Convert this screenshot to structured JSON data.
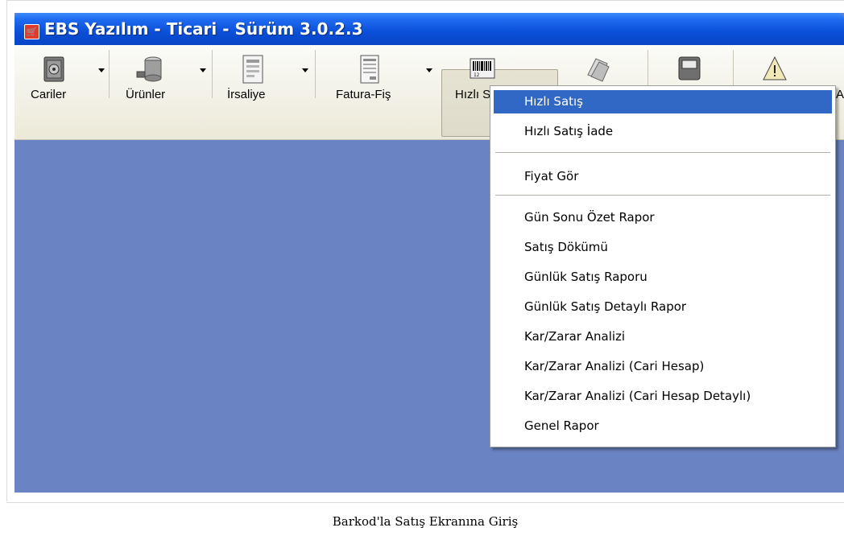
{
  "window": {
    "title": "EBS Yazılım - Ticari - Sürüm 3.0.2.3",
    "app_icon": "cart-icon",
    "app_icon_glyph": "⌘"
  },
  "toolbar": {
    "items": [
      {
        "label": "Cariler",
        "icon": "safe-icon",
        "has_dropdown": true
      },
      {
        "label": "Ürünler",
        "icon": "database-icon",
        "has_dropdown": true
      },
      {
        "label": "İrsaliye",
        "icon": "document-icon",
        "has_dropdown": true
      },
      {
        "label": "Fatura-Fiş",
        "icon": "invoice-icon",
        "has_dropdown": true
      },
      {
        "label": "Hızlı S",
        "icon": "barcode-icon",
        "has_dropdown": true,
        "pressed": true
      },
      {
        "label": "",
        "icon": "cash-icon",
        "has_dropdown": false
      },
      {
        "label": "",
        "icon": "pos-icon",
        "has_dropdown": false
      },
      {
        "label": "",
        "icon": "warning-icon",
        "has_dropdown": false
      },
      {
        "label": "A",
        "icon": "",
        "has_dropdown": false
      }
    ]
  },
  "menu": {
    "items": [
      {
        "label": "Hızlı Satış",
        "active": true
      },
      {
        "label": "Hızlı Satış İade"
      },
      {
        "separator": true
      },
      {
        "label": "Fiyat Gör"
      },
      {
        "separator": true
      },
      {
        "label": "Gün Sonu Özet Rapor"
      },
      {
        "label": "Satış Dökümü"
      },
      {
        "label": "Günlük Satış Raporu"
      },
      {
        "label": "Günlük Satış Detaylı Rapor"
      },
      {
        "label": "Kar/Zarar Analizi"
      },
      {
        "label": "Kar/Zarar Analizi (Cari Hesap)"
      },
      {
        "label": "Kar/Zarar Analizi (Cari Hesap Detaylı)"
      },
      {
        "label": "Genel Rapor"
      }
    ]
  },
  "caption": "Barkod'la Satış Ekranına Giriş",
  "colors": {
    "desktop": "#6a83c2",
    "titlebar": "#0a4fd8",
    "menu_highlight": "#3168c5"
  }
}
